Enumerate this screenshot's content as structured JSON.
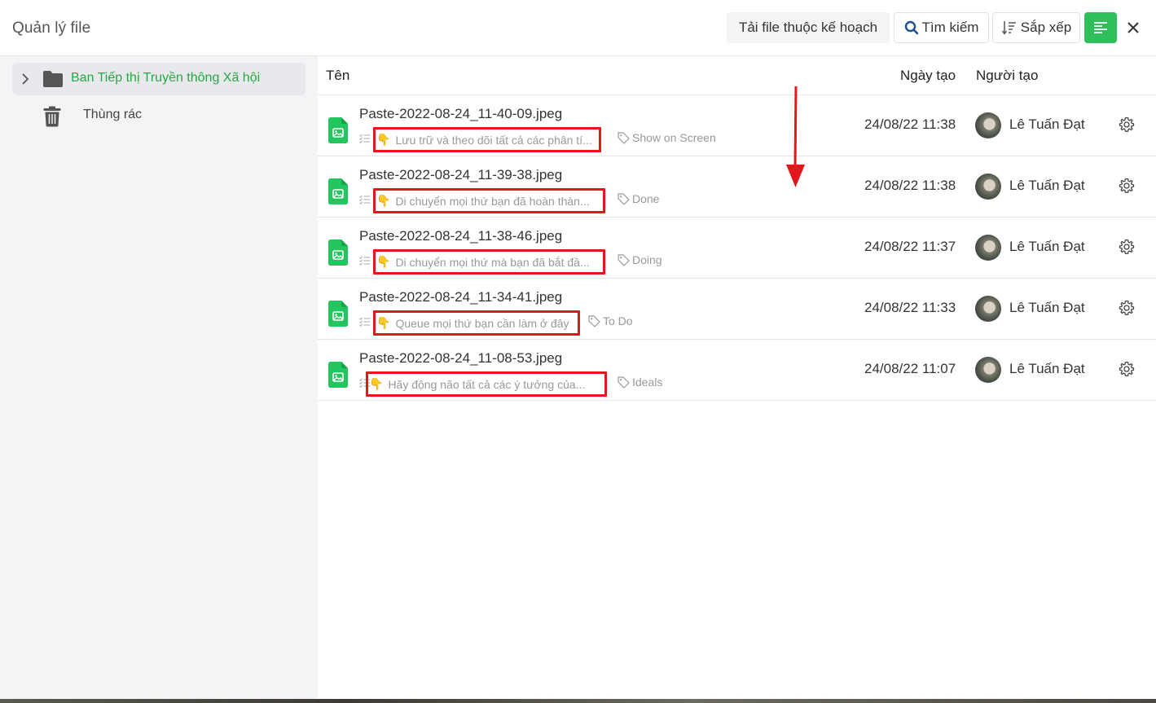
{
  "header": {
    "title": "Quản lý file",
    "btn_plan": "Tải file thuộc kế hoạch",
    "btn_search": "Tìm kiếm",
    "btn_sort": "Sắp xếp"
  },
  "sidebar": {
    "folder_label": "Ban Tiếp thị Truyền thông Xã hội",
    "trash_label": "Thùng rác"
  },
  "columns": {
    "name": "Tên",
    "date": "Ngày tạo",
    "creator": "Người tạo"
  },
  "files": [
    {
      "name": "Paste-2022-08-24_11-40-09.jpeg",
      "desc": "Lưu trữ và theo dõi tất cả các phân tí...",
      "tag": "Show on Screen",
      "date": "24/08/22 11:38",
      "creator": "Lê Tuấn Đạt"
    },
    {
      "name": "Paste-2022-08-24_11-39-38.jpeg",
      "desc": "Di chuyển mọi thứ bạn đã hoàn thàn...",
      "tag": "Done",
      "date": "24/08/22 11:38",
      "creator": "Lê Tuấn Đạt"
    },
    {
      "name": "Paste-2022-08-24_11-38-46.jpeg",
      "desc": "Di chuyển mọi thứ mà bạn đã bắt đầ...",
      "tag": "Doing",
      "date": "24/08/22 11:37",
      "creator": "Lê Tuấn Đạt"
    },
    {
      "name": "Paste-2022-08-24_11-34-41.jpeg",
      "desc": "Queue mọi thứ bạn cần làm ở đây",
      "tag": "To Do",
      "date": "24/08/22 11:33",
      "creator": "Lê Tuấn Đạt"
    },
    {
      "name": "Paste-2022-08-24_11-08-53.jpeg",
      "desc": "Hãy động não tất cả các ý tưởng của...",
      "tag": "Ideals",
      "date": "24/08/22 11:07",
      "creator": "Lê Tuấn Đạt"
    }
  ],
  "emoji": "👇",
  "colors": {
    "accent_green": "#2fbf5a",
    "folder_green": "#27a844",
    "annotation_red": "#e3161b"
  }
}
